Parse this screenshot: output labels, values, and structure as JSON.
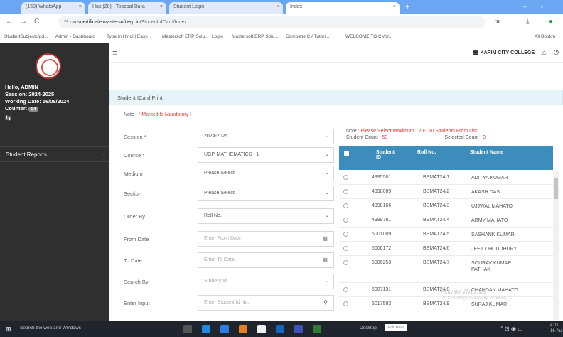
{
  "browser": {
    "tabs": [
      {
        "label": "(150) WhatsApp"
      },
      {
        "label": "Hax (28) - Topcoal Bara"
      },
      {
        "label": "Student Login"
      },
      {
        "label": "Index"
      }
    ],
    "url_host": "cimsoertificate.mastersoftierp.in",
    "url_path": "/StudentIdCard/Index",
    "bookmarks": [
      "StudentSubjectUpd...",
      "Admin - Dashboard",
      "Type in Hindi | Easy...",
      "Mastersoft ERP Solu...",
      "Login",
      "Mastersoft ERP Solu...",
      "Complete C# Tutori...",
      "WELCOME TO CMU...",
      "All Bookm"
    ]
  },
  "sidebar": {
    "greeting": "Hello, ADMIN",
    "session": "Session: 2024-2025",
    "working_date": "Working Date: 16/08/2024",
    "counter_label": "Counter:",
    "counter_value": "04",
    "menu_item": "Student Reports"
  },
  "topbar": {
    "college": "KARIM CITY COLLEGE"
  },
  "panel": {
    "title": "Student ICard Print",
    "note_prefix": "Note : ",
    "note_text": "* Marked Is Mandatory !"
  },
  "form": {
    "session": {
      "label": "Session *",
      "value": "2024-2025"
    },
    "course": {
      "label": "Course *",
      "value": "UGP-MATHEMATICS - 1"
    },
    "medium": {
      "label": "Medium",
      "value": "Please Select"
    },
    "section": {
      "label": "Section",
      "value": "Please Select"
    },
    "order_by": {
      "label": "Order By",
      "value": "Roll No."
    },
    "from_date": {
      "label": "From Date",
      "placeholder": "Enter From Date"
    },
    "to_date": {
      "label": "To Date",
      "placeholder": "Enter To Date"
    },
    "search_by": {
      "label": "Search By",
      "value": "Student Id"
    },
    "enter_input": {
      "label": "Enter Input",
      "placeholder": "Enter Student Id No."
    }
  },
  "list": {
    "note_prefix": "Note : ",
    "note_text": "Please Select Maximum 120-150 Students From List",
    "student_count_label": "Student Count :",
    "student_count": "53",
    "selected_count_label": "Selected Count :",
    "selected_count": "0",
    "headers": {
      "id": "Student ID",
      "roll": "Roll No.",
      "name": "Student Name"
    },
    "rows": [
      {
        "id": "4995501",
        "roll": "BSMAT24/1",
        "name": "ADITYA KUMAR"
      },
      {
        "id": "4998089",
        "roll": "BSMAT24/2",
        "name": "AKASH DAS"
      },
      {
        "id": "4998166",
        "roll": "BSMAT24/3",
        "name": "UJJWAL MAHATO"
      },
      {
        "id": "4999781",
        "roll": "BSMAT24/4",
        "name": "ARMY MAHATO"
      },
      {
        "id": "5001009",
        "roll": "BSMAT24/5",
        "name": "SASHANK KUMAR"
      },
      {
        "id": "5006172",
        "roll": "BSMAT24/6",
        "name": "JEET CHOUDHURY"
      },
      {
        "id": "5006253",
        "roll": "BSMAT24/7",
        "name": "SOURAV KUMAR PATHAK"
      },
      {
        "id": "5007131",
        "roll": "BSMAT24/8",
        "name": "CHANDAN MAHATO"
      },
      {
        "id": "5017583",
        "roll": "BSMAT24/9",
        "name": "SURAJ KUMAR"
      }
    ]
  },
  "watermark": {
    "line1": "Activate Windows",
    "line2": "Go to Settings to activate Windows."
  },
  "taskbar": {
    "search": "Search the web and Windows",
    "desktop": "Desktop",
    "address": "Address",
    "time": "4:01",
    "date": "16-Au"
  }
}
